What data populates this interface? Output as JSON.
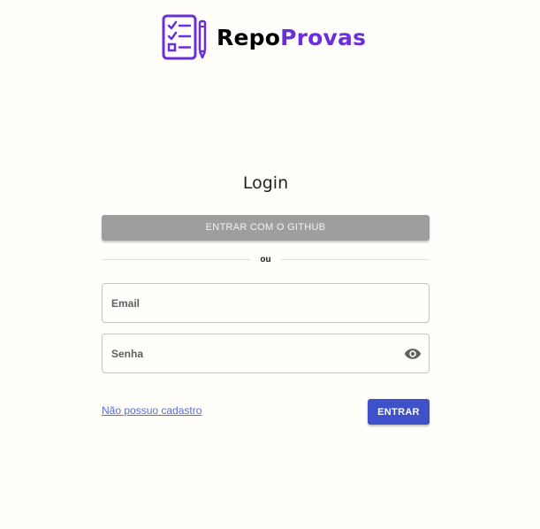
{
  "app": {
    "logo_text_part1": "Repo",
    "logo_text_part2": "Provas",
    "logo_icon": "checklist-pencil-icon",
    "brand_color": "#6a2fd8"
  },
  "login": {
    "title": "Login",
    "github_button_label": "ENTRAR COM O GITHUB",
    "divider_text": "ou",
    "email_placeholder": "Email",
    "password_placeholder": "Senha",
    "password_toggle_icon": "eye-icon",
    "signup_link": "Não possuo cadastro",
    "submit_label": "ENTRAR"
  },
  "colors": {
    "github_button": "#9e9e9e",
    "submit_button": "#3f51c8",
    "link": "#5a6bd4",
    "background": "#fffefb"
  }
}
